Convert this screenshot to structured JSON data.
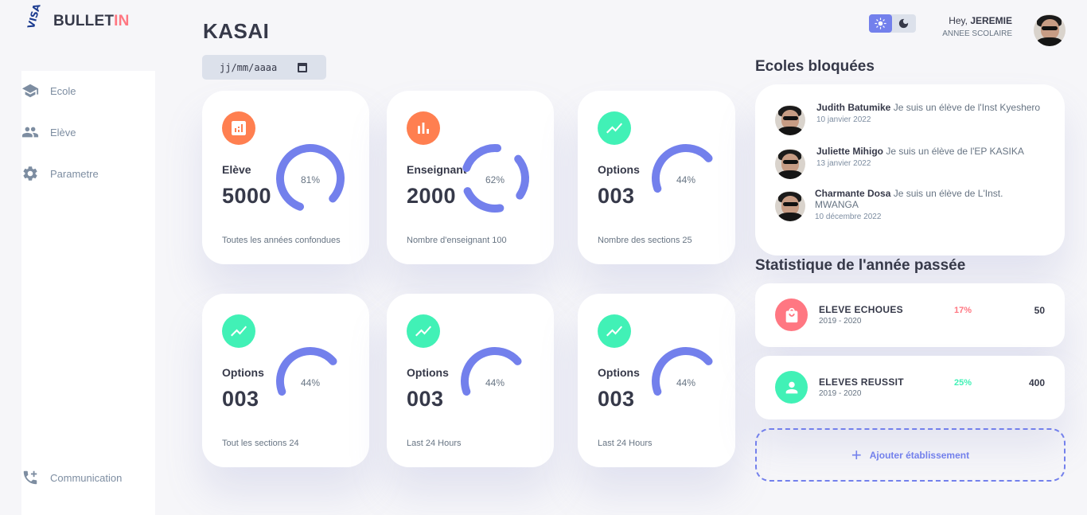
{
  "brand": {
    "mark": "VISA",
    "name_main": "BULLET",
    "name_accent": "IN"
  },
  "sidebar": {
    "items": [
      {
        "label": "Ecole",
        "icon": "school-icon"
      },
      {
        "label": "Elève",
        "icon": "people-icon"
      },
      {
        "label": "Parametre",
        "icon": "gear-icon"
      }
    ],
    "bottom": {
      "label": "Communication",
      "icon": "phone-add-icon"
    }
  },
  "main": {
    "title": "KASAI",
    "date_placeholder": "jj/mm/aaaa",
    "cards": [
      {
        "title": "Elève",
        "value": "5000",
        "percent_label": "81%",
        "percent": 0.81,
        "footer": "Toutes les années confondues",
        "icon": "chart-icon",
        "icon_color": "#ff7f50",
        "gauge_style": "solid"
      },
      {
        "title": "Enseignant",
        "value": "2000",
        "percent_label": "62%",
        "percent": 0.62,
        "footer": "Nombre d'enseignant 100",
        "icon": "bar-chart-icon",
        "icon_color": "#ff7f50",
        "gauge_style": "segmented"
      },
      {
        "title": "Options",
        "value": "003",
        "percent_label": "44%",
        "percent": 0.44,
        "footer": "Nombre des sections 25",
        "icon": "trending-icon",
        "icon_color": "#41f1b6",
        "gauge_style": "solid"
      },
      {
        "title": "Options",
        "value": "003",
        "percent_label": "44%",
        "percent": 0.44,
        "footer": "Tout les sections 24",
        "icon": "trending-icon",
        "icon_color": "#41f1b6",
        "gauge_style": "solid"
      },
      {
        "title": "Options",
        "value": "003",
        "percent_label": "44%",
        "percent": 0.44,
        "footer": "Last 24 Hours",
        "icon": "trending-icon",
        "icon_color": "#41f1b6",
        "gauge_style": "solid"
      },
      {
        "title": "Options",
        "value": "003",
        "percent_label": "44%",
        "percent": 0.44,
        "footer": "Last 24 Hours",
        "icon": "trending-icon",
        "icon_color": "#41f1b6",
        "gauge_style": "solid"
      }
    ]
  },
  "header": {
    "theme": {
      "light_icon": "sun-icon",
      "dark_icon": "moon-icon",
      "active": "light"
    },
    "greeting": "Hey, ",
    "user_name": "JEREMIE",
    "subtitle": "ANNEE SCOLAIRE"
  },
  "blocked": {
    "title": "Ecoles bloquées",
    "items": [
      {
        "name": "Judith Batumike",
        "text": " Je suis un élève de l'Inst Kyeshero",
        "date": "10 janvier 2022"
      },
      {
        "name": "Juliette Mihigo",
        "text": " Je suis un élève de l'EP KASIKA",
        "date": "13 janvier 2022"
      },
      {
        "name": "Charmante Dosa",
        "text": " Je suis un élève de L'Inst. MWANGA",
        "date": "10 décembre 2022"
      }
    ]
  },
  "stats": {
    "title": "Statistique de l'année passée",
    "items": [
      {
        "name": "ELEVE ECHOUES",
        "year": "2019 - 2020",
        "percent": "17%",
        "count": "50",
        "icon": "shopping-bag-icon",
        "color": "#ff7782"
      },
      {
        "name": "ELEVES REUSSIT",
        "year": "2019 - 2020",
        "percent": "25%",
        "count": "400",
        "icon": "person-icon",
        "color": "#41f1b6"
      }
    ]
  },
  "add_button": {
    "label": "Ajouter établissement",
    "icon": "plus-icon"
  },
  "colors": {
    "primary": "#7380ec",
    "danger": "#ff7782",
    "success": "#41f1b6",
    "warning": "#ff7f50",
    "background": "#f6f6f9"
  }
}
